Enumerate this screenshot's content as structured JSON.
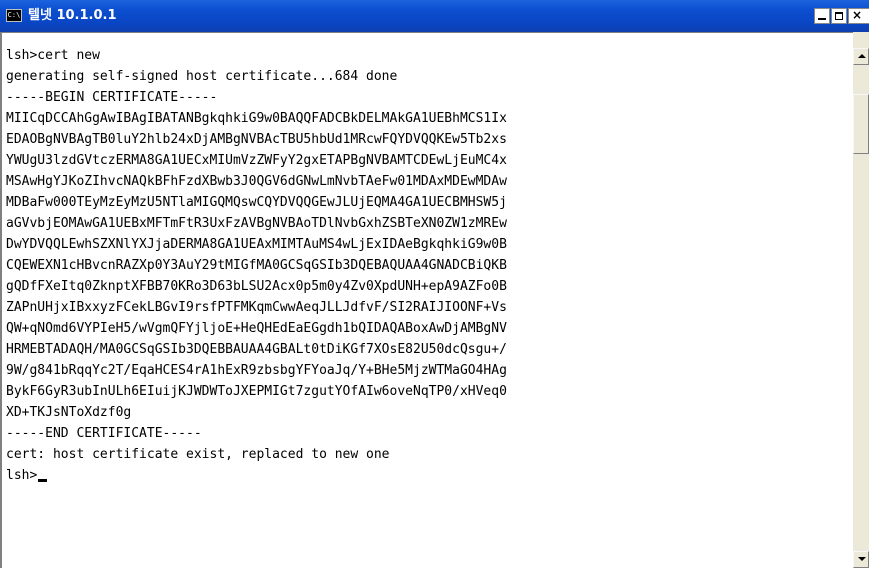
{
  "window": {
    "icon_text": "C:\\",
    "title": "텔넷 10.1.0.1",
    "buttons": {
      "minimize": "_",
      "maximize": "□",
      "close": "×"
    }
  },
  "console": {
    "lines": [
      "lsh>cert new",
      "generating self-signed host certificate...684 done",
      "-----BEGIN CERTIFICATE-----",
      "MIICqDCCAhGgAwIBAgIBATANBgkqhkiG9w0BAQQFADCBkDELMAkGA1UEBhMCS1Ix",
      "EDAOBgNVBAgTB0luY2hlb24xDjAMBgNVBAcTBU5hbUd1MRcwFQYDVQQKEw5Tb2xs",
      "YWUgU3lzdGVtczERMA8GA1UECxMIUmVzZWFyY2gxETAPBgNVBAMTCDEwLjEuMC4x",
      "MSAwHgYJKoZIhvcNAQkBFhFzdXBwb3J0QGV6dGNwLmNvbTAeFw01MDAxMDEwMDAw",
      "MDBaFw000TEyMzEyMzU5NTlaMIGQMQswCQYDVQQGEwJLUjEQMA4GA1UECBMHSW5j",
      "aGVvbjEOMAwGA1UEBxMFTmFtR3UxFzAVBgNVBAoTDlNvbGxhZSBTeXN0ZW1zMREw",
      "DwYDVQQLEwhSZXNlYXJjaDERMA8GA1UEAxMIMTAuMS4wLjExIDAeBgkqhkiG9w0B",
      "CQEWEXN1cHBvcnRAZXp0Y3AuY29tMIGfMA0GCSqGSIb3DQEBAQUAA4GNADCBiQKB",
      "gQDfFXeItq0ZknptXFBB70KRo3D63bLSU2Acx0p5m0y4Zv0XpdUNH+epA9AZFo0B",
      "ZAPnUHjxIBxxyzFCekLBGvI9rsfPTFMKqmCwwAeqJLLJdfvF/SI2RAIJIOONF+Vs",
      "QW+qNOmd6VYPIeH5/wVgmQFYjljoE+HeQHEdEaEGgdh1bQIDAQABoxAwDjAMBgNV",
      "HRMEBTADAQH/MA0GCSqGSIb3DQEBBAUAA4GBALt0tDiKGf7XOsE82U50dcQsgu+/",
      "9W/g841bRqqYc2T/EqaHCES4rA1hExR9zbsbgYFYoaJq/Y+BHe5MjzWTMaGO4HAg",
      "BykF6GyR3ubInULh6EIuijKJWDWToJXEPMIGt7zgutYOfAIw6oveNqTP0/xHVeq0",
      "XD+TKJsNToXdzf0g",
      "-----END CERTIFICATE-----",
      "cert: host certificate exist, replaced to new one"
    ],
    "prompt": "lsh>"
  }
}
